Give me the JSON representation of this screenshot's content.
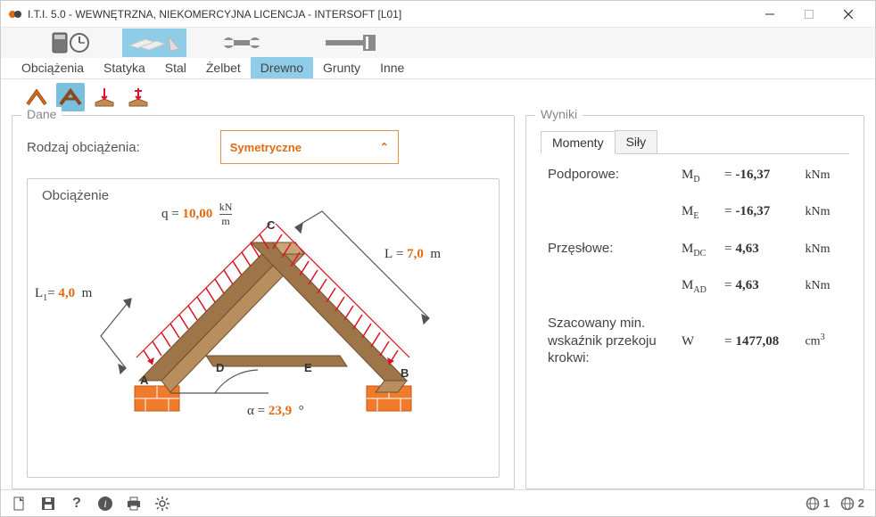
{
  "window": {
    "title": "I.T.I. 5.0 - WEWNĘTRZNA, NIEKOMERCYJNA LICENCJA - INTERSOFT [L01]"
  },
  "colors": {
    "accent_blue": "#8fcce8",
    "accent_orange": "#e06a14",
    "panel_border": "#cccccc"
  },
  "tabs": {
    "items": [
      {
        "label": "Obciążenia"
      },
      {
        "label": "Statyka"
      },
      {
        "label": "Stal"
      },
      {
        "label": "Żelbet"
      },
      {
        "label": "Drewno",
        "active": true
      },
      {
        "label": "Grunty"
      },
      {
        "label": "Inne"
      }
    ]
  },
  "left": {
    "panel_title": "Dane",
    "load_type_label": "Rodzaj obciążenia:",
    "load_type_value": "Symetryczne",
    "diagram": {
      "title": "Obciążenie",
      "q_label": "q",
      "q_value": "10,00",
      "q_unit_top": "kN",
      "q_unit_bot": "m",
      "L_label": "L",
      "L_value": "7,0",
      "L_unit": "m",
      "L1_label": "L₁",
      "L1_value": "4,0",
      "L1_unit": "m",
      "alpha_label": "α",
      "alpha_value": "23,9",
      "alpha_unit": "°",
      "nodes": {
        "A": "A",
        "B": "B",
        "C": "C",
        "D": "D",
        "E": "E"
      }
    }
  },
  "right": {
    "panel_title": "Wyniki",
    "tabs": [
      {
        "label": "Momenty",
        "active": true
      },
      {
        "label": "Siły"
      }
    ],
    "groups": {
      "support_label": "Podporowe:",
      "field_label": "Przęsłowe:",
      "section_label": "Szacowany min. wskaźnik przekoju krokwi:"
    },
    "results": {
      "MD": {
        "sym": "M",
        "sub": "D",
        "val": "-16,37",
        "unit": "kNm"
      },
      "ME": {
        "sym": "M",
        "sub": "E",
        "val": "-16,37",
        "unit": "kNm"
      },
      "MDC": {
        "sym": "M",
        "sub": "DC",
        "val": "4,63",
        "unit": "kNm"
      },
      "MAD": {
        "sym": "M",
        "sub": "AD",
        "val": "4,63",
        "unit": "kNm"
      },
      "W": {
        "sym": "W",
        "sub": "",
        "val": "1477,08",
        "unit": "cm",
        "unit_sup": "3"
      }
    }
  },
  "status": {
    "right1": "1",
    "right2": "2"
  }
}
